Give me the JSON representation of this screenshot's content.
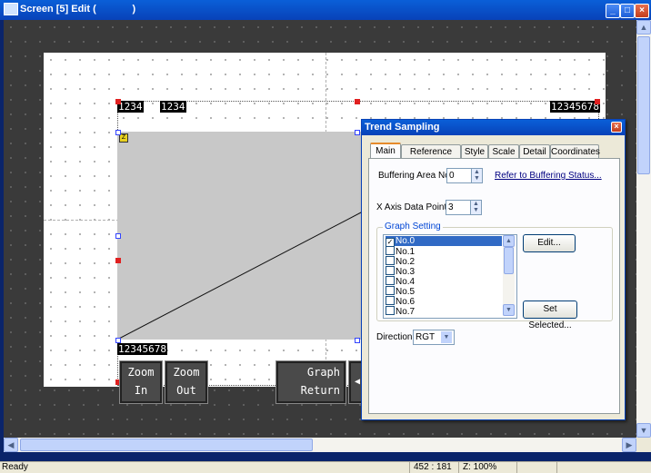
{
  "window": {
    "title": "Screen [5] Edit (             )",
    "buttons": {
      "minimize": "_",
      "maximize": "□",
      "close": "×"
    }
  },
  "canvas": {
    "labels": {
      "top_left_1": "1234",
      "top_left_2": "1234",
      "top_right": "12345678",
      "bottom_left": "12345678"
    },
    "buttons": [
      {
        "line1": "Zoom",
        "line2": "In"
      },
      {
        "line1": "Zoom",
        "line2": "Out"
      },
      {
        "line1": "Graph",
        "line2": "Return"
      }
    ]
  },
  "dialog": {
    "title": "Trend Sampling",
    "close": "×",
    "tabs": [
      "Main",
      "Reference Line",
      "Style",
      "Scale",
      "Detail",
      "Coordinates"
    ],
    "active_tab": "Main",
    "buffering_area_label": "Buffering Area No.",
    "buffering_area_value": "0",
    "refer_link": "Refer to Buffering Status...",
    "x_axis_label": "X Axis Data Points",
    "x_axis_value": "3",
    "graph_setting_label": "Graph Setting",
    "graph_items": [
      {
        "label": "No.0",
        "checked": true
      },
      {
        "label": "No.1",
        "checked": false
      },
      {
        "label": "No.2",
        "checked": false
      },
      {
        "label": "No.3",
        "checked": false
      },
      {
        "label": "No.4",
        "checked": false
      },
      {
        "label": "No.5",
        "checked": false
      },
      {
        "label": "No.6",
        "checked": false
      },
      {
        "label": "No.7",
        "checked": false
      }
    ],
    "edit_button": "Edit...",
    "set_selected_button": "Set Selected...",
    "direction_label": "Direction",
    "direction_value": "RGT"
  },
  "status": {
    "text": "Ready",
    "coords": "452 : 181",
    "zoom": "Z: 100%"
  }
}
